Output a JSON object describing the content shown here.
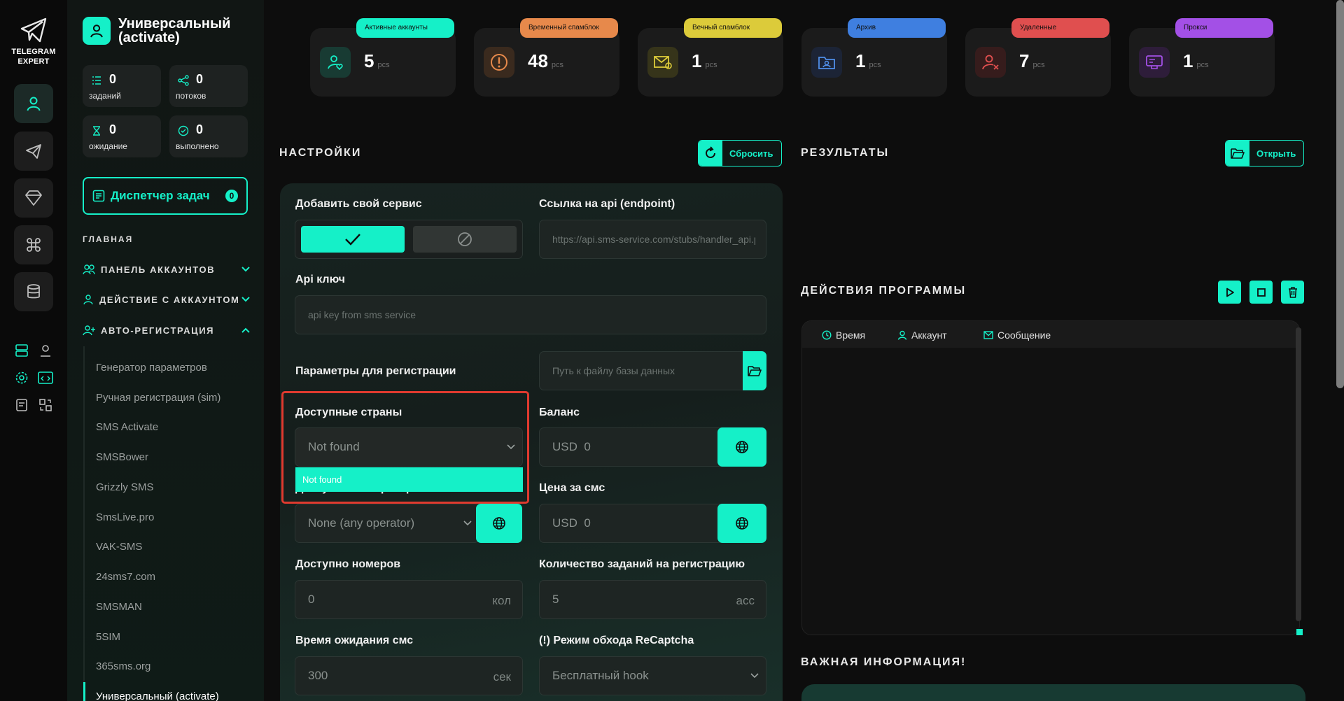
{
  "app": {
    "logo_line1": "TELEGRAM",
    "logo_line2": "EXPERT"
  },
  "sidebar": {
    "title": "Универсальный",
    "subtitle": "(activate)",
    "stats": [
      {
        "value": "0",
        "label": "заданий"
      },
      {
        "value": "0",
        "label": "потоков"
      },
      {
        "value": "0",
        "label": "ожидание"
      },
      {
        "value": "0",
        "label": "выполнено"
      }
    ],
    "dispatcher": {
      "label": "Диспетчер задач",
      "count": "0"
    },
    "section": "ГЛАВНАЯ",
    "menu": [
      {
        "label": "ПАНЕЛЬ АККАУНТОВ"
      },
      {
        "label": "ДЕЙСТВИЕ С АККАУНТОМ"
      },
      {
        "label": "АВТО-РЕГИСТРАЦИЯ"
      }
    ],
    "sub_items": [
      "Генератор параметров",
      "Ручная регистрация (sim)",
      "SMS Activate",
      "SMSBower",
      "Grizzly SMS",
      "SmsLive.pro",
      "VAK-SMS",
      "24sms7.com",
      "SMSMAN",
      "5SIM",
      "365sms.org",
      "Универсальный (activate)"
    ]
  },
  "top_stats": [
    {
      "badge": "Активные аккаунты",
      "value": "5",
      "unit": "pcs",
      "color": "#15f0c8"
    },
    {
      "badge": "Временный спамблок",
      "value": "48",
      "unit": "pcs",
      "color": "#e7894b"
    },
    {
      "badge": "Вечный спамблок",
      "value": "1",
      "unit": "pcs",
      "color": "#dccb3a"
    },
    {
      "badge": "Архив",
      "value": "1",
      "unit": "pcs",
      "color": "#3f7fe0"
    },
    {
      "badge": "Удаленные",
      "value": "7",
      "unit": "pcs",
      "color": "#e04f4f"
    },
    {
      "badge": "Прокси",
      "value": "1",
      "unit": "pcs",
      "color": "#a350e6"
    }
  ],
  "settings": {
    "heading": "НАСТРОЙКИ",
    "reset_label": "Сбросить",
    "own_service_label": "Добавить свой сервис",
    "endpoint_label": "Ссылка на api (endpoint)",
    "endpoint_placeholder": "https://api.sms-service.com/stubs/handler_api.php",
    "api_key_label": "Api ключ",
    "api_key_placeholder": "api key from sms service",
    "reg_params_label": "Параметры для регистрации",
    "db_path_placeholder": "Путь к файлу базы данных",
    "countries_label": "Доступные страны",
    "countries_value": "Not found",
    "countries_option": "Not found",
    "operators_label": "Доступные операторы",
    "operators_value": "None (any operator)",
    "balance_label": "Баланс",
    "balance_currency": "USD",
    "balance_value": "0",
    "sms_price_label": "Цена за смс",
    "sms_price_currency": "USD",
    "sms_price_value": "0",
    "numbers_label": "Доступно номеров",
    "numbers_value": "0",
    "numbers_unit": "кол",
    "tasks_label": "Количество заданий на регистрацию",
    "tasks_value": "5",
    "tasks_unit": "acc",
    "sms_wait_label": "Время ожидания смс",
    "sms_wait_value": "300",
    "sms_wait_unit": "сек",
    "recaptcha_label": "(!) Режим обхода ReCaptcha",
    "recaptcha_value": "Бесплатный hook"
  },
  "results": {
    "heading": "РЕЗУЛЬТАТЫ",
    "open_label": "Открыть"
  },
  "actions": {
    "heading": "ДЕЙСТВИЯ ПРОГРАММЫ",
    "columns": [
      "Время",
      "Аккаунт",
      "Сообщение"
    ]
  },
  "info": {
    "heading": "ВАЖНАЯ ИНФОРМАЦИЯ!"
  },
  "colors": {
    "accent": "#15f0c8",
    "highlight": "#e03a2f"
  }
}
